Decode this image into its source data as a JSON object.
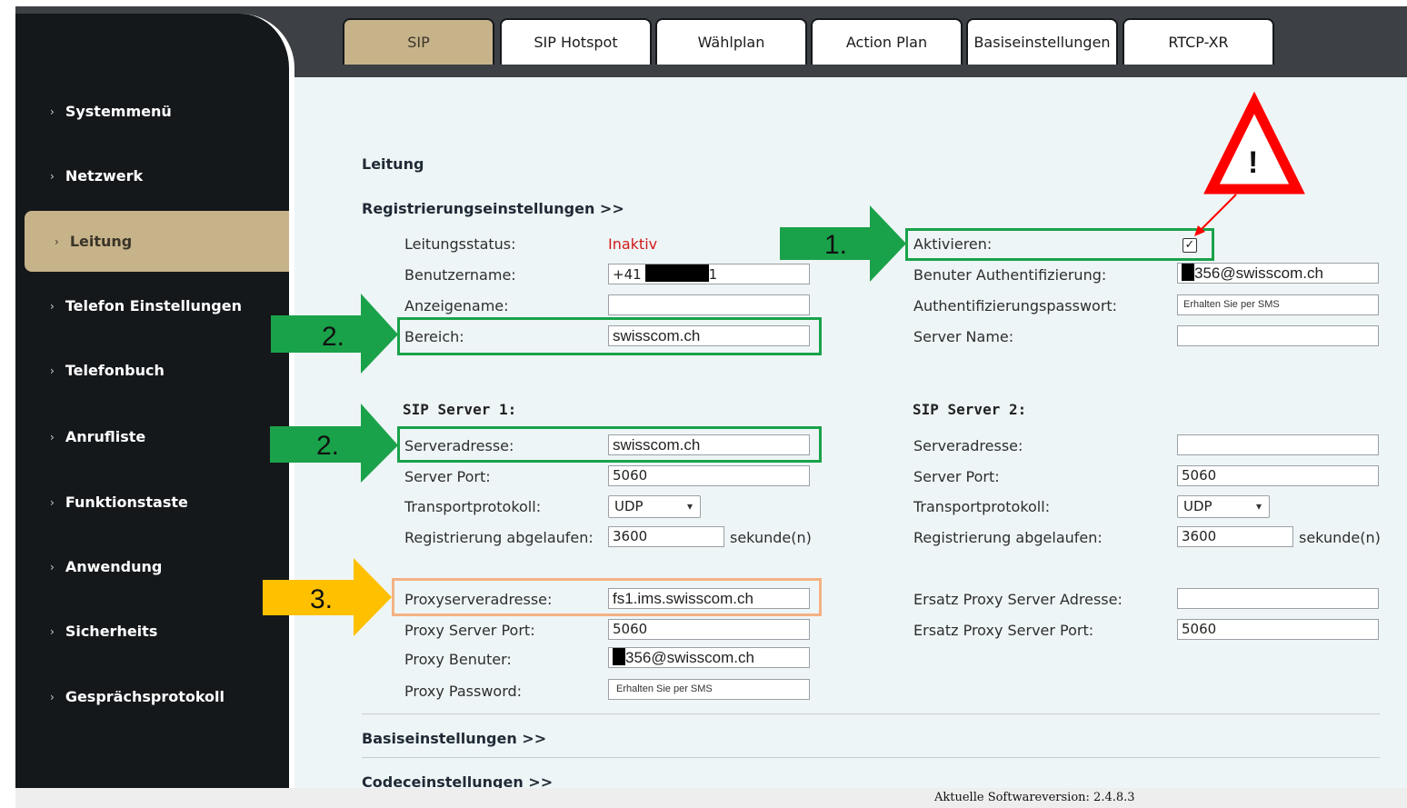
{
  "tabs": [
    "SIP",
    "SIP Hotspot",
    "Wählplan",
    "Action Plan",
    "Basiseinstellungen",
    "RTCP-XR"
  ],
  "sidebar": {
    "items": [
      "Systemmenü",
      "Netzwerk",
      "Leitung",
      "Telefon Einstellungen",
      "Telefonbuch",
      "Anrufliste",
      "Funktionstaste",
      "Anwendung",
      "Sicherheits",
      "Gesprächsprotokoll"
    ],
    "active": "Leitung"
  },
  "main": {
    "section_title": "Leitung",
    "reg_settings": "Registrierungseinstellungen >>",
    "left": {
      "line_status_label": "Leitungsstatus:",
      "line_status_value": "Inaktiv",
      "username_label": "Benutzername:",
      "username_prefix": "+41",
      "username_suffix": "1",
      "display_name_label": "Anzeigename:",
      "display_name_value": "",
      "realm_label": "Bereich:",
      "realm_value": "swisscom.ch"
    },
    "right": {
      "activate_label": "Aktivieren:",
      "activate_checked": true,
      "auth_user_label": "Benuter Authentifizierung:",
      "auth_user_value": "356@swisscom.ch",
      "auth_pass_label": "Authentifizierungspasswort:",
      "auth_pass_value": "Erhalten Sie per SMS",
      "server_name_label": "Server Name:",
      "server_name_value": ""
    },
    "sip1": {
      "title": "SIP Server 1:",
      "address_label": "Serveradresse:",
      "address_value": "swisscom.ch",
      "port_label": "Server Port:",
      "port_value": "5060",
      "transport_label": "Transportprotokoll:",
      "transport_value": "UDP",
      "expire_label": "Registrierung abgelaufen:",
      "expire_value": "3600",
      "expire_unit": "sekunde(n)"
    },
    "sip2": {
      "title": "SIP Server 2:",
      "address_label": "Serveradresse:",
      "address_value": "",
      "port_label": "Server Port:",
      "port_value": "5060",
      "transport_label": "Transportprotokoll:",
      "transport_value": "UDP",
      "expire_label": "Registrierung abgelaufen:",
      "expire_value": "3600",
      "expire_unit": "sekunde(n)"
    },
    "proxy": {
      "address_label": "Proxyserveradresse:",
      "address_value": "fs1.ims.swisscom.ch",
      "port_label": "Proxy Server Port:",
      "port_value": "5060",
      "user_label": "Proxy Benuter:",
      "user_value": "356@swisscom.ch",
      "pass_label": "Proxy Password:",
      "pass_value": "Erhalten Sie per SMS",
      "backup_address_label": "Ersatz Proxy Server Adresse:",
      "backup_address_value": "",
      "backup_port_label": "Ersatz Proxy Server Port:",
      "backup_port_value": "5060"
    },
    "basic_settings": "Basiseinstellungen >>",
    "codec_settings": "Codeceinstellungen >>"
  },
  "annotations": {
    "step1": "1.",
    "step2a": "2.",
    "step2b": "2.",
    "step3": "3.",
    "warning": "!",
    "colors": {
      "green": "#1aa24a",
      "orange_box": "#f4b183",
      "yellow_arrow": "#ffc000",
      "red": "#ff0000"
    }
  },
  "footer": {
    "version": "Aktuelle Softwareversion: 2.4.8.3"
  }
}
